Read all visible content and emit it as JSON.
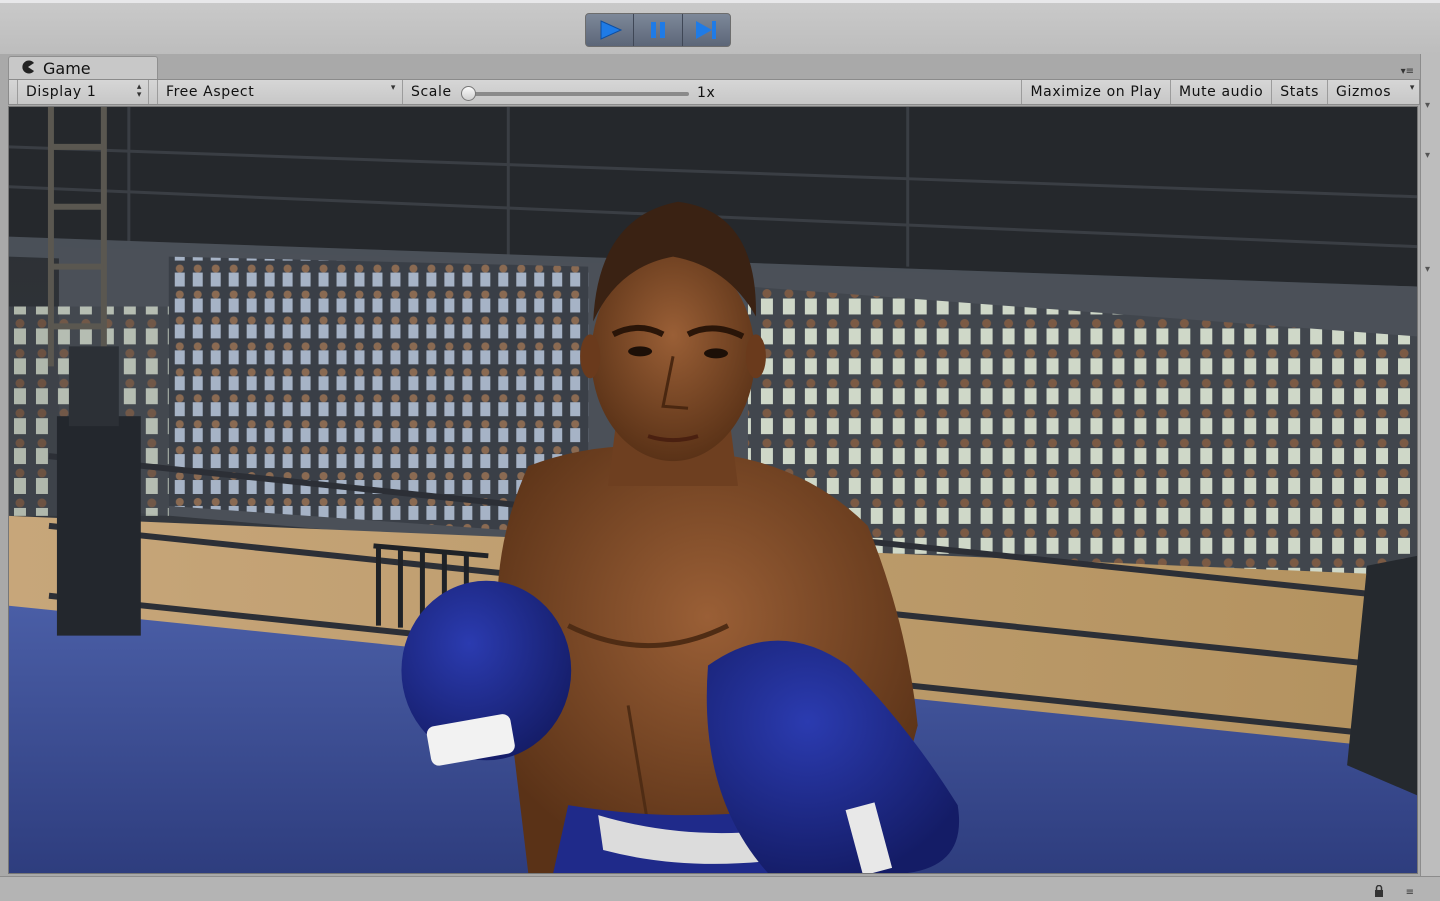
{
  "window": {
    "tab_title": "Game",
    "tab_icon": "pacman-icon"
  },
  "play_controls": {
    "play": "play-icon",
    "pause": "pause-icon",
    "step": "step-icon",
    "accent_color": "#1f7be6"
  },
  "game_toolbar": {
    "display": "Display 1",
    "aspect": "Free Aspect",
    "scale_label": "Scale",
    "scale_value": "1x",
    "scale_level": 0.0,
    "maximize_on_play": "Maximize on Play",
    "mute_audio": "Mute audio",
    "stats": "Stats",
    "gizmos": "Gizmos"
  },
  "scene": {
    "description_icons": [
      "boxer-figure",
      "crowd",
      "boxing-ring"
    ],
    "glove_color": "#1f2a8a",
    "mat_color": "#3d4f94",
    "floor_color": "#b89a6f"
  }
}
